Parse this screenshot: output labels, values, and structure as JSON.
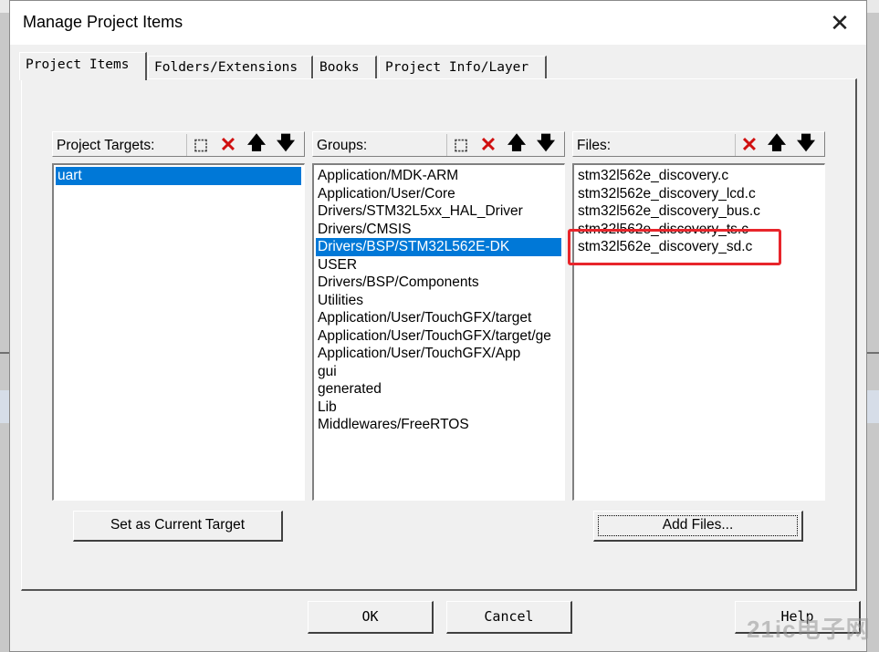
{
  "dialog": {
    "title": "Manage Project Items"
  },
  "tabs": [
    {
      "label": "Project Items"
    },
    {
      "label": "Folders/Extensions"
    },
    {
      "label": "Books"
    },
    {
      "label": "Project Info/Layer"
    }
  ],
  "targets": {
    "header": "Project Targets:",
    "items": [
      "uart"
    ],
    "selected": "uart"
  },
  "groups": {
    "header": "Groups:",
    "items": [
      "Application/MDK-ARM",
      "Application/User/Core",
      "Drivers/STM32L5xx_HAL_Driver",
      "Drivers/CMSIS",
      "Drivers/BSP/STM32L562E-DK",
      "USER",
      "Drivers/BSP/Components",
      "Utilities",
      "Application/User/TouchGFX/target",
      "Application/User/TouchGFX/target/ge",
      "Application/User/TouchGFX/App",
      "gui",
      "generated",
      "Lib",
      "Middlewares/FreeRTOS"
    ],
    "selected": "Drivers/BSP/STM32L562E-DK"
  },
  "files": {
    "header": "Files:",
    "items": [
      "stm32l562e_discovery.c",
      "stm32l562e_discovery_lcd.c",
      "stm32l562e_discovery_bus.c",
      "stm32l562e_discovery_ts.c",
      "stm32l562e_discovery_sd.c"
    ]
  },
  "buttons": {
    "set_current_target": "Set as Current Target",
    "add_files": "Add Files...",
    "ok": "OK",
    "cancel": "Cancel",
    "help": "Help"
  },
  "watermark": "21ic电子网",
  "colors": {
    "selection": "#0078d7",
    "highlight_box": "#e8252b",
    "delete_icon": "#d01010"
  }
}
